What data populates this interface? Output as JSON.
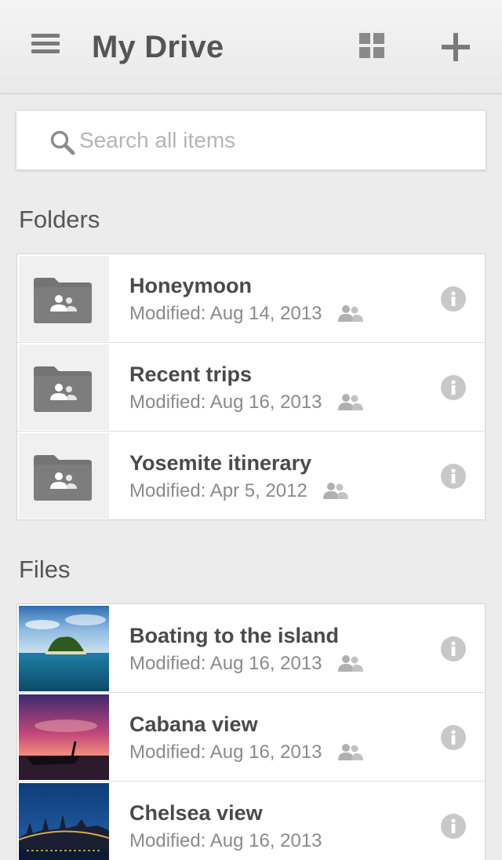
{
  "header": {
    "title": "My Drive"
  },
  "search": {
    "placeholder": "Search all items",
    "value": ""
  },
  "folders_section": {
    "title": "Folders",
    "items": [
      {
        "name": "Honeymoon",
        "modified": "Modified: Aug 14, 2013",
        "shared": true
      },
      {
        "name": "Recent trips",
        "modified": "Modified: Aug 16, 2013",
        "shared": true
      },
      {
        "name": "Yosemite itinerary",
        "modified": "Modified: Apr 5, 2012",
        "shared": true
      }
    ]
  },
  "files_section": {
    "title": "Files",
    "items": [
      {
        "name": "Boating to the island",
        "modified": "Modified: Aug 16, 2013",
        "shared": true
      },
      {
        "name": "Cabana view",
        "modified": "Modified: Aug 16, 2013",
        "shared": true
      },
      {
        "name": "Chelsea view",
        "modified": "Modified: Aug 16, 2013",
        "shared": false
      }
    ]
  },
  "icons": {
    "menu": "menu-icon",
    "grid": "grid-view-icon",
    "add": "add-icon",
    "search": "search-icon",
    "folder": "shared-folder-icon",
    "people": "shared-people-icon",
    "info": "info-icon"
  },
  "colors": {
    "background": "#ececec",
    "icon_gray": "#7a7a7a",
    "title_gray": "#555555",
    "meta_gray": "#8a8a8a",
    "info_gray": "#c8c8c8"
  }
}
